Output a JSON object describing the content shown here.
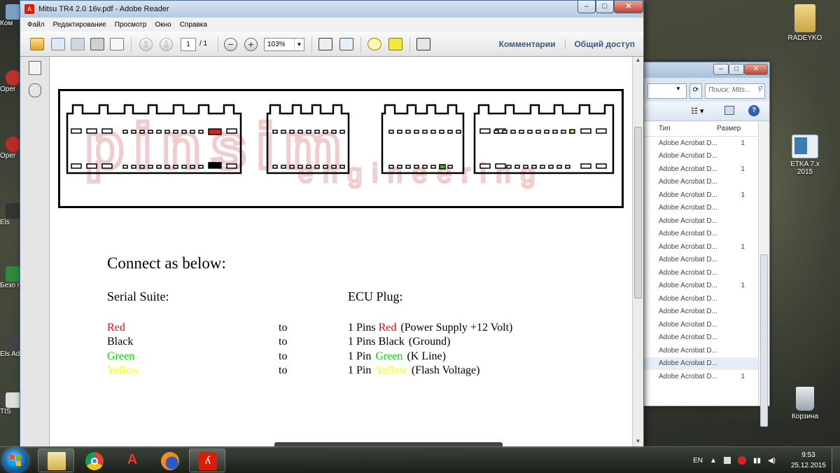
{
  "reader": {
    "title": "Mitsu TR4 2.0 16v.pdf - Adobe Reader",
    "menu": [
      "Файл",
      "Редактирование",
      "Просмотр",
      "Окно",
      "Справка"
    ],
    "page_current": "1",
    "page_total": "/ 1",
    "zoom": "103%",
    "links": {
      "comments": "Комментарии",
      "share": "Общий доступ"
    }
  },
  "document": {
    "watermark_brand": "pinsim",
    "watermark_sub": "engineering",
    "heading": "Connect as below:",
    "col_left": "Serial Suite:",
    "col_right": "ECU Plug:",
    "rows": [
      {
        "wire": "Red",
        "wire_color": "#ff0000",
        "to": "to",
        "pin": "1 Pins",
        "pin_color_name": "Red",
        "desc": "(Power Supply +12 Volt)"
      },
      {
        "wire": "Black",
        "wire_color": "#000000",
        "to": "to",
        "pin": "1 Pins",
        "pin_color_name": "Black",
        "desc": "(Ground)"
      },
      {
        "wire": "Green",
        "wire_color": "#00e000",
        "to": "to",
        "pin": "1 Pin",
        "pin_color_name": "Green",
        "desc": "(K Line)"
      },
      {
        "wire": "Yellow",
        "wire_color": "#ffff00",
        "to": "to",
        "pin": "1 Pin",
        "pin_color_name": "Yellow",
        "desc": "(Flash Voltage)"
      }
    ],
    "pin_colors": {
      "red": "#e02020",
      "black": "#000000",
      "green": "#2cc02c",
      "yellow": "#e8e020"
    }
  },
  "explorer": {
    "search_placeholder": "Поиск: Mits...",
    "col_type": "Тип",
    "col_size": "Размер",
    "rows": [
      {
        "type": "Adobe Acrobat D...",
        "size": "1"
      },
      {
        "type": "Adobe Acrobat D...",
        "size": ""
      },
      {
        "type": "Adobe Acrobat D...",
        "size": "1"
      },
      {
        "type": "Adobe Acrobat D...",
        "size": ""
      },
      {
        "type": "Adobe Acrobat D...",
        "size": "1"
      },
      {
        "type": "Adobe Acrobat D...",
        "size": ""
      },
      {
        "type": "Adobe Acrobat D...",
        "size": ""
      },
      {
        "type": "Adobe Acrobat D...",
        "size": ""
      },
      {
        "type": "Adobe Acrobat D...",
        "size": "1"
      },
      {
        "type": "Adobe Acrobat D...",
        "size": ""
      },
      {
        "type": "Adobe Acrobat D...",
        "size": ""
      },
      {
        "type": "Adobe Acrobat D...",
        "size": "1"
      },
      {
        "type": "Adobe Acrobat D...",
        "size": ""
      },
      {
        "type": "Adobe Acrobat D...",
        "size": ""
      },
      {
        "type": "Adobe Acrobat D...",
        "size": ""
      },
      {
        "type": "Adobe Acrobat D...",
        "size": ""
      },
      {
        "type": "Adobe Acrobat D...",
        "size": ""
      },
      {
        "type": "Adobe Acrobat D...",
        "size": "",
        "selected": true
      },
      {
        "type": "Adobe Acrobat D...",
        "size": "1"
      }
    ]
  },
  "desktop": {
    "icons_right": [
      {
        "label": "RADEYKO",
        "icon": "folder-icon"
      },
      {
        "label": "ETKA 7.x 2015",
        "icon": "shortcut-icon"
      },
      {
        "label": "Корзина",
        "icon": "recycle-bin-icon"
      }
    ],
    "icons_left": [
      "Ком",
      "Oper",
      "Oper",
      "Els",
      "Безо пли",
      "Els Adm",
      "TIS"
    ]
  },
  "taskbar": {
    "lang": "EN",
    "time": "9:53",
    "date": "25.12.2015",
    "apps": [
      "explorer",
      "chrome",
      "autodata",
      "firefox",
      "adobe-reader"
    ]
  }
}
